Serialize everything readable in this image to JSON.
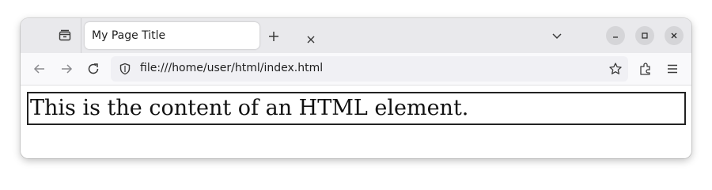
{
  "tabbar": {
    "tab_title": "My Page Title",
    "icons": {
      "tabs_menu": "tabs-overview-icon",
      "close_tab": "close-icon",
      "new_tab": "plus-icon",
      "list_all_tabs": "chevron-down-icon",
      "minimize": "minimize-icon",
      "maximize": "maximize-icon",
      "close_window": "close-icon"
    }
  },
  "navbar": {
    "url": "file:///home/user/html/index.html",
    "icons": {
      "back": "arrow-left-icon",
      "forward": "arrow-right-icon",
      "reload": "reload-icon",
      "site_info": "shield-icon",
      "bookmark": "star-icon",
      "extensions": "puzzle-icon",
      "menu": "hamburger-menu-icon"
    }
  },
  "page": {
    "element_text": "This is the content of an HTML element."
  },
  "colors": {
    "tabbar_bg": "#e9e9ec",
    "navbar_bg": "#f9f9fb",
    "urlbar_bg": "#f0f0f4",
    "element_border": "#222222"
  }
}
